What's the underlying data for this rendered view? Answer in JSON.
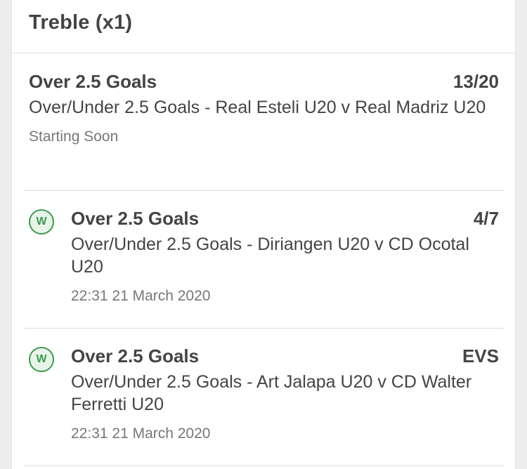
{
  "header": {
    "title": "Treble (x1)"
  },
  "selections": [
    {
      "name": "Over 2.5 Goals",
      "odds": "13/20",
      "market": "Over/Under 2.5 Goals - Real Esteli U20 v Real Madriz U20",
      "status": "Starting Soon"
    },
    {
      "badge": "W",
      "name": "Over 2.5 Goals",
      "odds": "4/7",
      "market": "Over/Under 2.5 Goals - Diriangen U20 v CD Ocotal U20",
      "status": "22:31 21 March 2020"
    },
    {
      "badge": "W",
      "name": "Over 2.5 Goals",
      "odds": "EVS",
      "market": "Over/Under 2.5 Goals - Art Jalapa U20 v CD Walter Ferretti U20",
      "status": "22:31 21 March 2020"
    }
  ],
  "colors": {
    "win_badge": "#3e9a4d",
    "text": "#444444",
    "muted": "#777777"
  }
}
